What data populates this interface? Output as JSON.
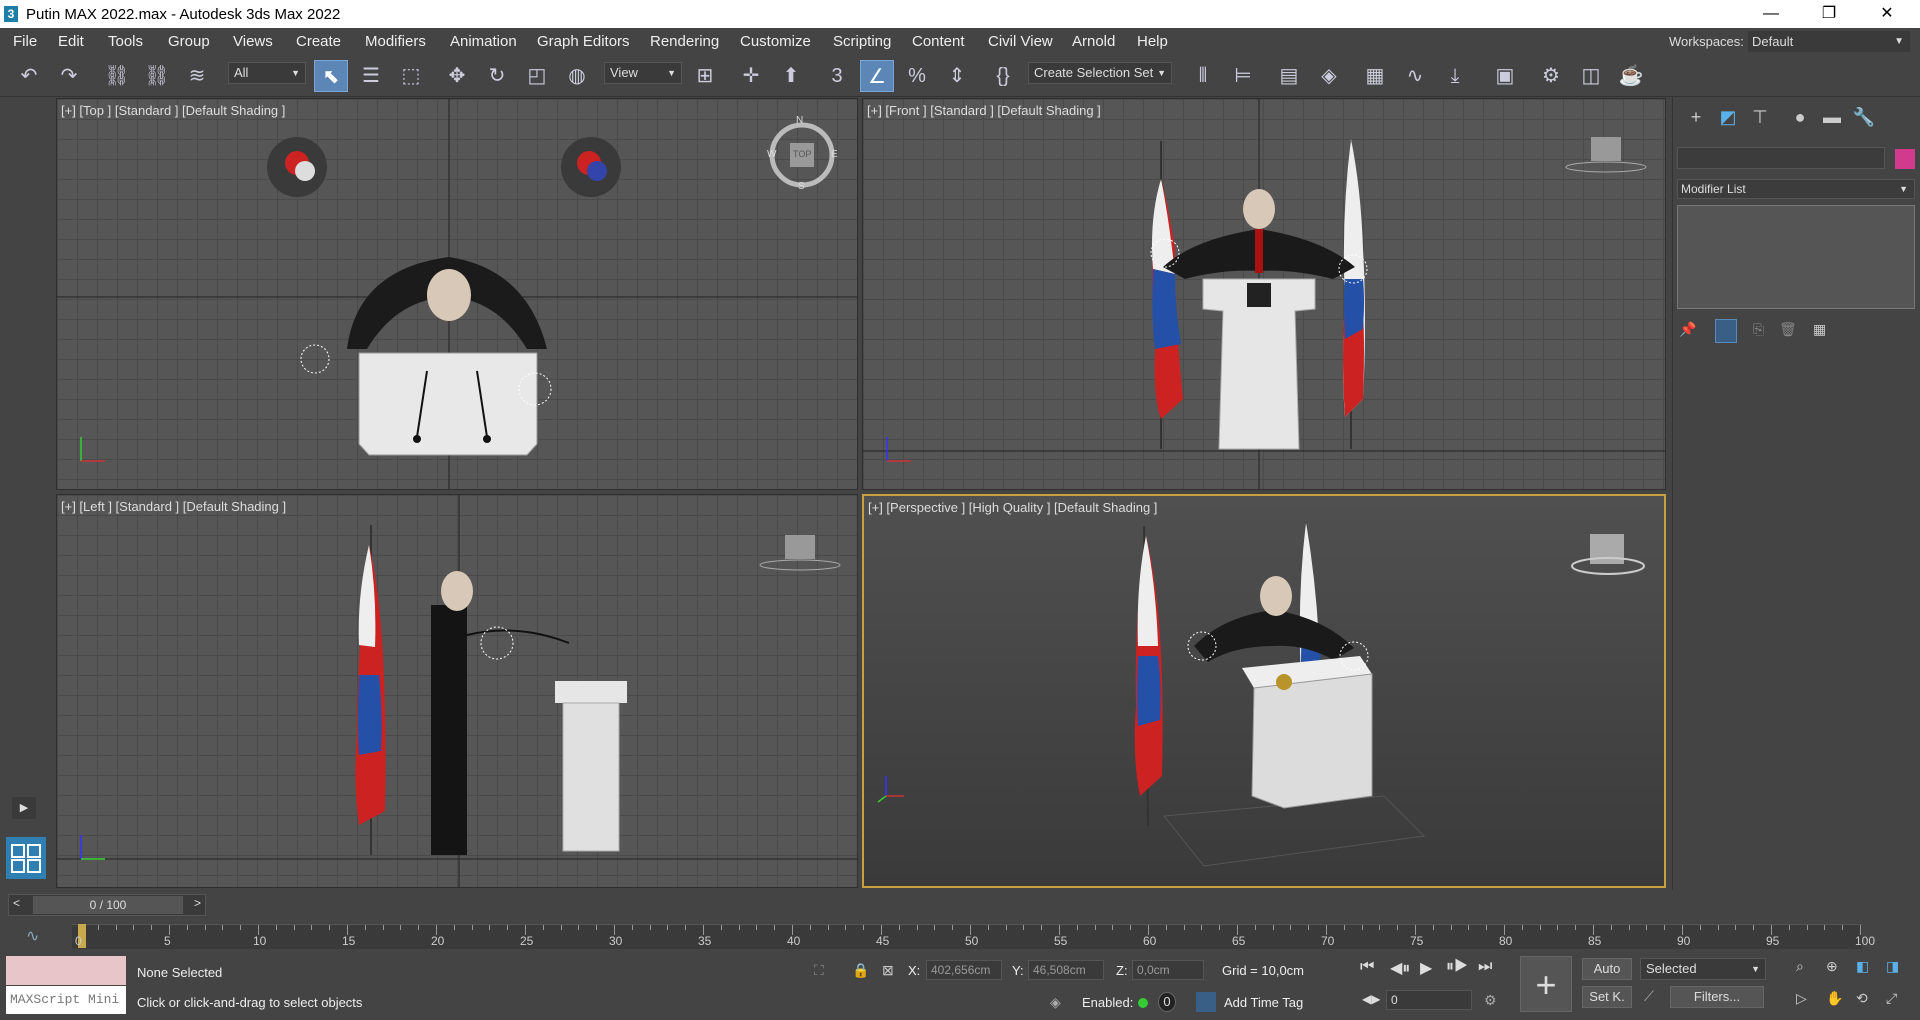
{
  "window": {
    "title": "Putin MAX 2022.max - Autodesk 3ds Max 2022",
    "app_icon": "3",
    "buttons": {
      "minimize": "—",
      "restore": "❐",
      "close": "✕"
    }
  },
  "menu": {
    "items": [
      "File",
      "Edit",
      "Tools",
      "Group",
      "Views",
      "Create",
      "Modifiers",
      "Animation",
      "Graph Editors",
      "Rendering",
      "Customize",
      "Scripting",
      "Content",
      "Civil View",
      "Arnold",
      "Help"
    ],
    "workspaces_label": "Workspaces:",
    "workspaces_value": "Default"
  },
  "toolbar": {
    "filter_value": "All",
    "refcoord_value": "View",
    "selection_set_value": "Create Selection Set"
  },
  "viewports": {
    "top": {
      "label": "[+] [Top ] [Standard ] [Default Shading ]",
      "nav_letters": {
        "n": "N",
        "s": "S",
        "w": "W",
        "e": "E",
        "cube": "TOP"
      }
    },
    "front": {
      "label": "[+] [Front ] [Standard ] [Default Shading ]"
    },
    "left": {
      "label": "[+] [Left ] [Standard ] [Default Shading ]"
    },
    "perspective": {
      "label": "[+] [Perspective ] [High Quality ] [Default Shading ]"
    }
  },
  "command_panel": {
    "modifier_list": "Modifier List",
    "swatch_color": "#d23a8e"
  },
  "timeline": {
    "frame_display": "0 / 100",
    "prev": "<",
    "next": ">",
    "tick_labels": [
      "0",
      "5",
      "10",
      "15",
      "20",
      "25",
      "30",
      "35",
      "40",
      "45",
      "50",
      "55",
      "60",
      "65",
      "70",
      "75",
      "80",
      "85",
      "90",
      "95",
      "100"
    ]
  },
  "status": {
    "maxscript_placeholder": "MAXScript Mini",
    "selection": "None Selected",
    "prompt": "Click or click-and-drag to select objects",
    "x_label": "X:",
    "x_value": "402,656cm",
    "y_label": "Y:",
    "y_value": "46,508cm",
    "z_label": "Z:",
    "z_value": "0,0cm",
    "grid": "Grid = 10,0cm",
    "enabled_label": "Enabled:",
    "enabled_value": "0",
    "add_time_tag": "Add Time Tag",
    "auto_label": "Auto",
    "setk_label": "Set K.",
    "selected_dropdown": "Selected",
    "filters_label": "Filters...",
    "frame_field": "0"
  }
}
